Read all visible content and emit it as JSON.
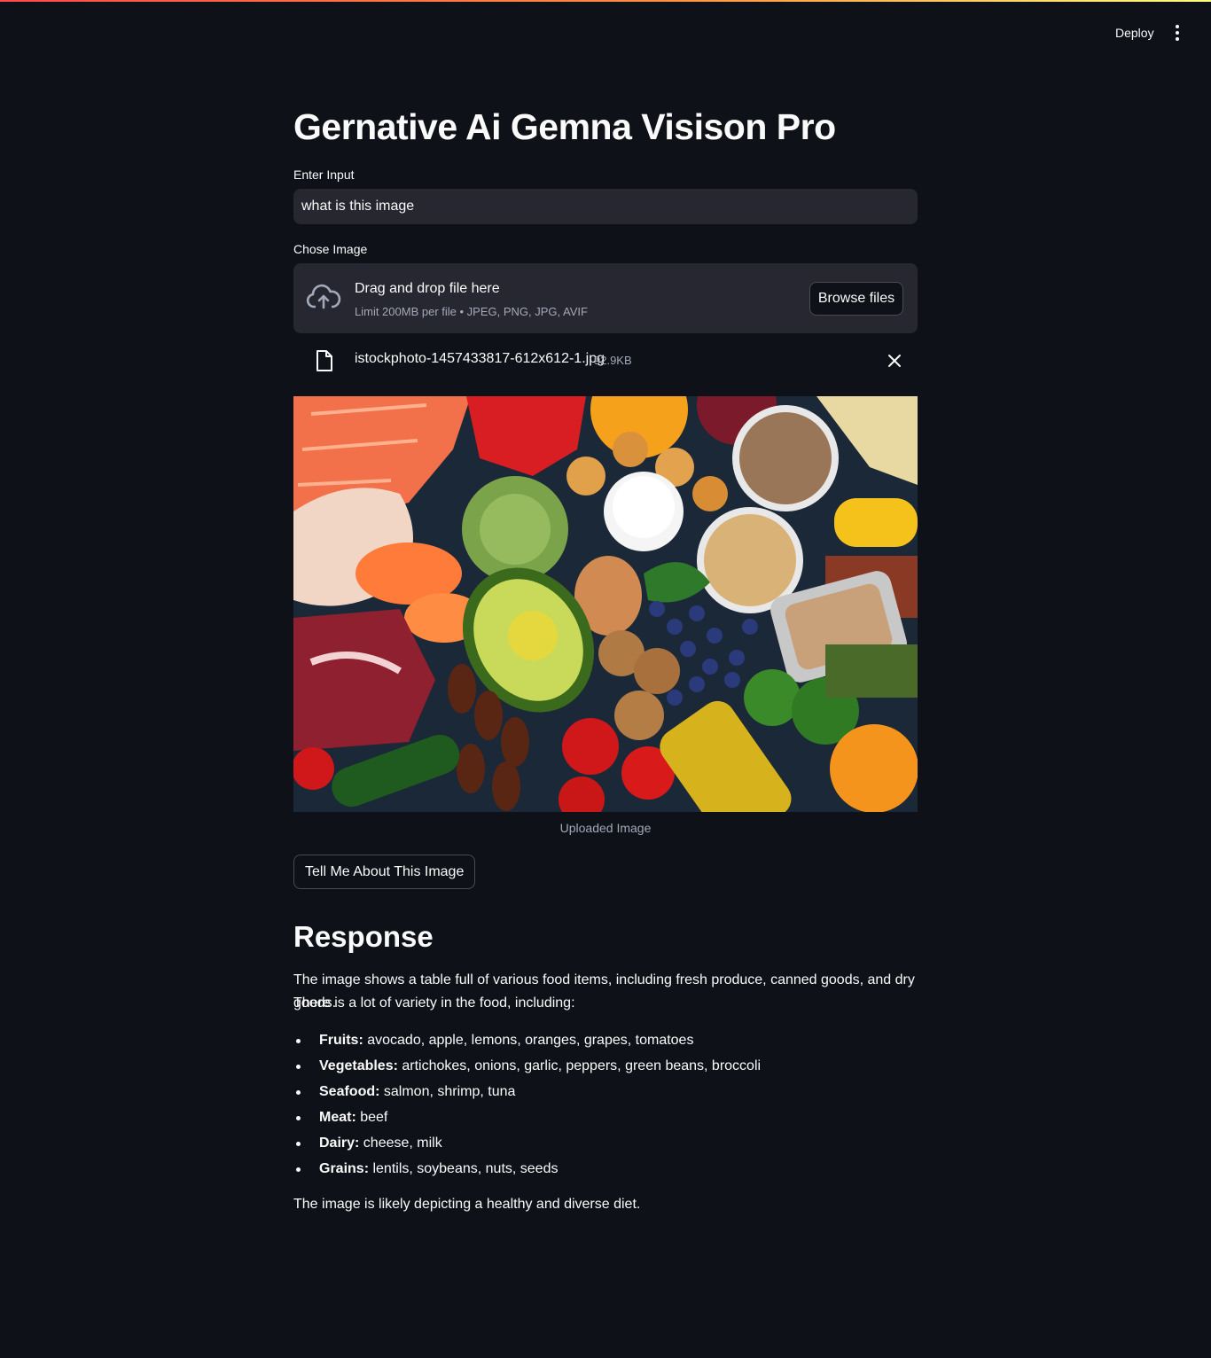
{
  "header": {
    "deploy_label": "Deploy",
    "menu_icon": "vertical-ellipsis-icon"
  },
  "page": {
    "title": "Gernative Ai Gemna Visison Pro"
  },
  "input": {
    "label": "Enter Input",
    "value": "what is this image"
  },
  "uploader": {
    "label": "Chose Image",
    "drop_title": "Drag and drop file here",
    "drop_subtitle": "Limit 200MB per file • JPEG, PNG, JPG, AVIF",
    "browse_label": "Browse files",
    "upload_icon": "cloud-upload-icon",
    "file": {
      "name": "istockphoto-1457433817-612x612-1.jpg",
      "size": "92.9KB",
      "icon": "file-icon",
      "remove_icon": "close-icon"
    }
  },
  "image": {
    "caption": "Uploaded Image"
  },
  "action": {
    "button_label": "Tell Me About This Image"
  },
  "response": {
    "heading": "Response",
    "intro_line1": "The image shows a table full of various food items, including fresh produce, canned goods, and dry goods.",
    "intro_line2": "There is a lot of variety in the food, including:",
    "items": [
      {
        "label": "Fruits:",
        "text": " avocado, apple, lemons, oranges, grapes, tomatoes"
      },
      {
        "label": "Vegetables:",
        "text": " artichokes, onions, garlic, peppers, green beans, broccoli"
      },
      {
        "label": "Seafood:",
        "text": " salmon, shrimp, tuna"
      },
      {
        "label": "Meat:",
        "text": " beef"
      },
      {
        "label": "Dairy:",
        "text": " cheese, milk"
      },
      {
        "label": "Grains:",
        "text": " lentils, soybeans, nuts, seeds"
      }
    ],
    "conclusion": "The image is likely depicting a healthy and diverse diet."
  },
  "colors": {
    "background": "#0e1117",
    "widget": "#262730",
    "text": "#fafafa",
    "muted": "#a3a8b8",
    "accent": "#ff4b4b"
  }
}
